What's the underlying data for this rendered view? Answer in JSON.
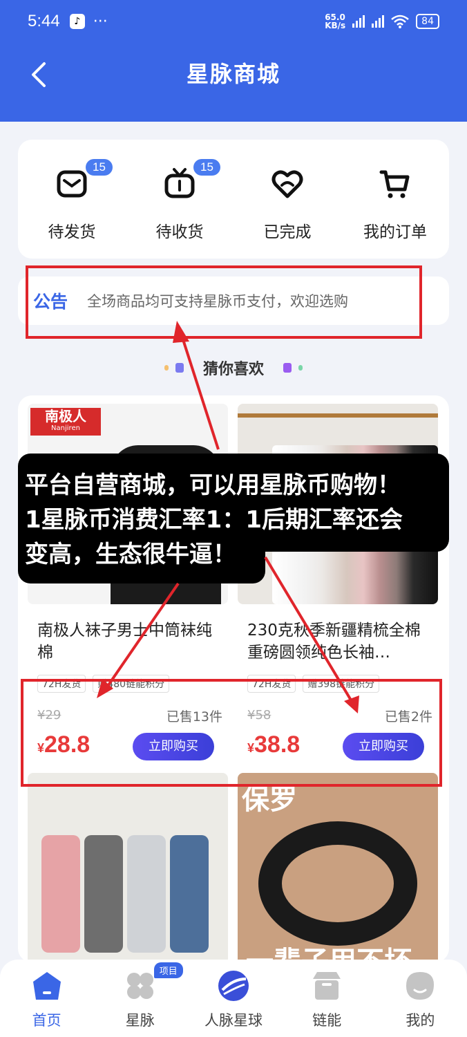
{
  "status_bar": {
    "time": "5:44",
    "net_speed_value": "65.0",
    "net_speed_unit": "KB/s",
    "battery": "84"
  },
  "header": {
    "title": "星脉商城"
  },
  "orders": [
    {
      "label": "待发货",
      "badge": "15"
    },
    {
      "label": "待收货",
      "badge": "15"
    },
    {
      "label": "已完成"
    },
    {
      "label": "我的订单"
    }
  ],
  "notice": {
    "tag": "公告",
    "text": "全场商品均可支持星脉币支付，欢迎选购"
  },
  "guess": {
    "label": "猜你喜欢"
  },
  "products": [
    {
      "brand": "南极人",
      "brand_sub": "Nanjiren",
      "name": "南极人袜子男士中筒袜纯棉",
      "tags": [
        "72H发货",
        "赠480链能积分"
      ],
      "old_price": "¥29",
      "sold": "已售13件",
      "currency": "¥",
      "price": "28.8",
      "buy_label": "立即购买"
    },
    {
      "name": "230克秋季新疆精梳全棉重磅圆领纯色长袖…",
      "tags": [
        "72H发货",
        "赠398链能积分"
      ],
      "old_price": "¥58",
      "sold": "已售2件",
      "currency": "¥",
      "price": "38.8",
      "buy_label": "立即购买"
    },
    {
      "name": ""
    },
    {
      "overlay_top": "保罗",
      "overlay_bottom": "一辈子用不坏"
    }
  ],
  "annotation": {
    "lines": [
      "平台自营商城，可以用星脉币购物！",
      "1星脉币消费汇率1：1后期汇率还会",
      "变高，生态很牛逼！"
    ],
    "color": "#e0252b"
  },
  "tabbar": [
    {
      "label": "首页",
      "active": true
    },
    {
      "label": "星脉",
      "badge": "项目"
    },
    {
      "label": "人脉星球"
    },
    {
      "label": "链能"
    },
    {
      "label": "我的"
    }
  ]
}
